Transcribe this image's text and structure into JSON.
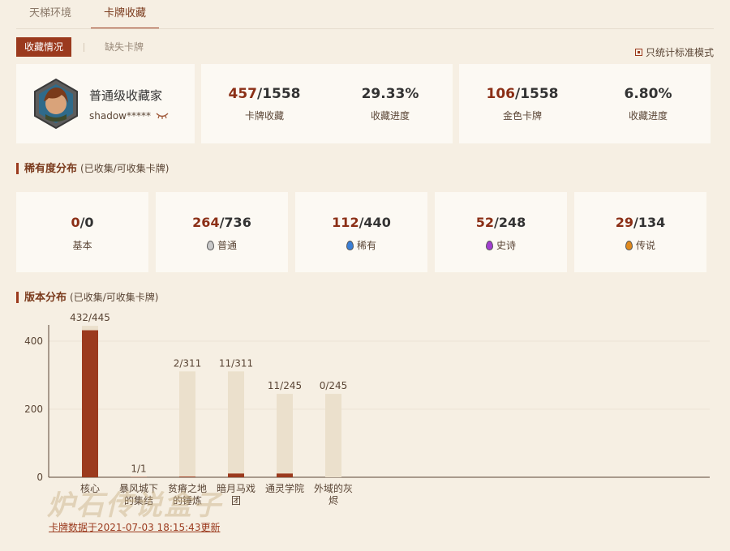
{
  "tabs": [
    {
      "label": "天梯环境"
    },
    {
      "label": "卡牌收藏"
    }
  ],
  "subtabs": {
    "active": "收藏情况",
    "inactive": "缺失卡牌"
  },
  "standard_mode_label": "只统计标准模式",
  "profile": {
    "rank_title": "普通级收藏家",
    "username": "shadow*****"
  },
  "collection": {
    "cards_owned": "457",
    "cards_total": "/1558",
    "cards_label": "卡牌收藏",
    "cards_progress": "29.33%",
    "cards_progress_label": "收藏进度",
    "golden_owned": "106",
    "golden_total": "/1558",
    "golden_label": "金色卡牌",
    "golden_progress": "6.80%",
    "golden_progress_label": "收藏进度"
  },
  "rarity_section": {
    "title": "稀有度分布",
    "subtitle": "(已收集/可收集卡牌)",
    "items": [
      {
        "owned": "0",
        "total": "/0",
        "label": "基本",
        "gem_color": ""
      },
      {
        "owned": "264",
        "total": "/736",
        "label": "普通",
        "gem_color": "#c9c9c9"
      },
      {
        "owned": "112",
        "total": "/440",
        "label": "稀有",
        "gem_color": "#3a7fd6"
      },
      {
        "owned": "52",
        "total": "/248",
        "label": "史诗",
        "gem_color": "#a23fd0"
      },
      {
        "owned": "29",
        "total": "/134",
        "label": "传说",
        "gem_color": "#e08a1e"
      }
    ]
  },
  "version_section": {
    "title": "版本分布",
    "subtitle": "(已收集/可收集卡牌)"
  },
  "chart_data": {
    "type": "bar",
    "categories": [
      "核心",
      "暴风城下的集结",
      "贫瘠之地的锤炼",
      "暗月马戏团",
      "通灵学院",
      "外域的灰烬"
    ],
    "category_lines": [
      [
        "核心"
      ],
      [
        "暴风城下",
        "的集结"
      ],
      [
        "贫瘠之地",
        "的锤炼"
      ],
      [
        "暗月马戏",
        "团"
      ],
      [
        "通灵学院"
      ],
      [
        "外域的灰",
        "烬"
      ]
    ],
    "series": [
      {
        "values": [
          432,
          1,
          2,
          11,
          11,
          0
        ]
      },
      {
        "values": [
          445,
          1,
          311,
          311,
          245,
          245
        ]
      }
    ],
    "data_labels": [
      "432/445",
      "1/1",
      "2/311",
      "11/311",
      "11/245",
      "0/245"
    ],
    "yticks": [
      "0",
      "200",
      "400"
    ],
    "ylim": [
      0,
      445
    ],
    "colors": {
      "owned": "#9b3a1e",
      "total": "#ebe0cc"
    }
  },
  "footer": {
    "updated": "卡牌数据于2021-07-03 18:15:43更新",
    "watermark": "炉石传说盒子"
  }
}
